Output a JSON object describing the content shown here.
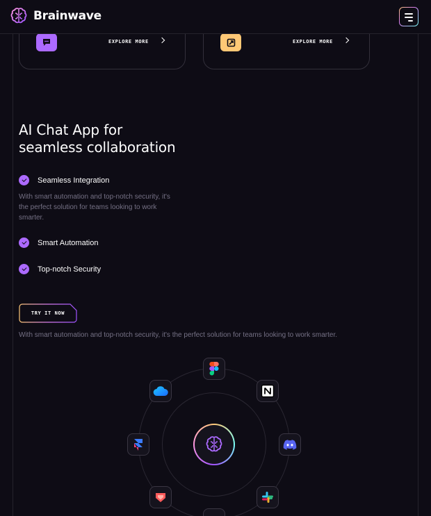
{
  "brand": {
    "name": "Brainwave",
    "accent": "#ac6aff"
  },
  "header": {
    "menu_icon": "hamburger-menu-icon"
  },
  "cards": [
    {
      "icon": "chat-bubble-icon",
      "icon_color": "#ac6aff",
      "link": "EXPLORE MORE"
    },
    {
      "icon": "expand-icon",
      "icon_color": "#ffc876",
      "link": "EXPLORE MORE"
    }
  ],
  "section": {
    "title_line1": "AI Chat App for",
    "title_line2": "seamless collaboration",
    "features": [
      {
        "title": "Seamless Integration",
        "description": "With smart automation and top-notch security, it's the perfect solution for teams looking to work smarter."
      },
      {
        "title": "Smart Automation"
      },
      {
        "title": "Top-notch Security"
      }
    ],
    "cta": "TRY IT NOW",
    "bottom_text": "With smart automation and top-notch security, it's the perfect solution for teams looking to work smarter."
  },
  "integrations": [
    "figma-icon",
    "notion-icon",
    "discord-icon",
    "slack-icon",
    "protopie-icon",
    "framer-icon",
    "cloud-icon",
    "bottom-icon"
  ]
}
